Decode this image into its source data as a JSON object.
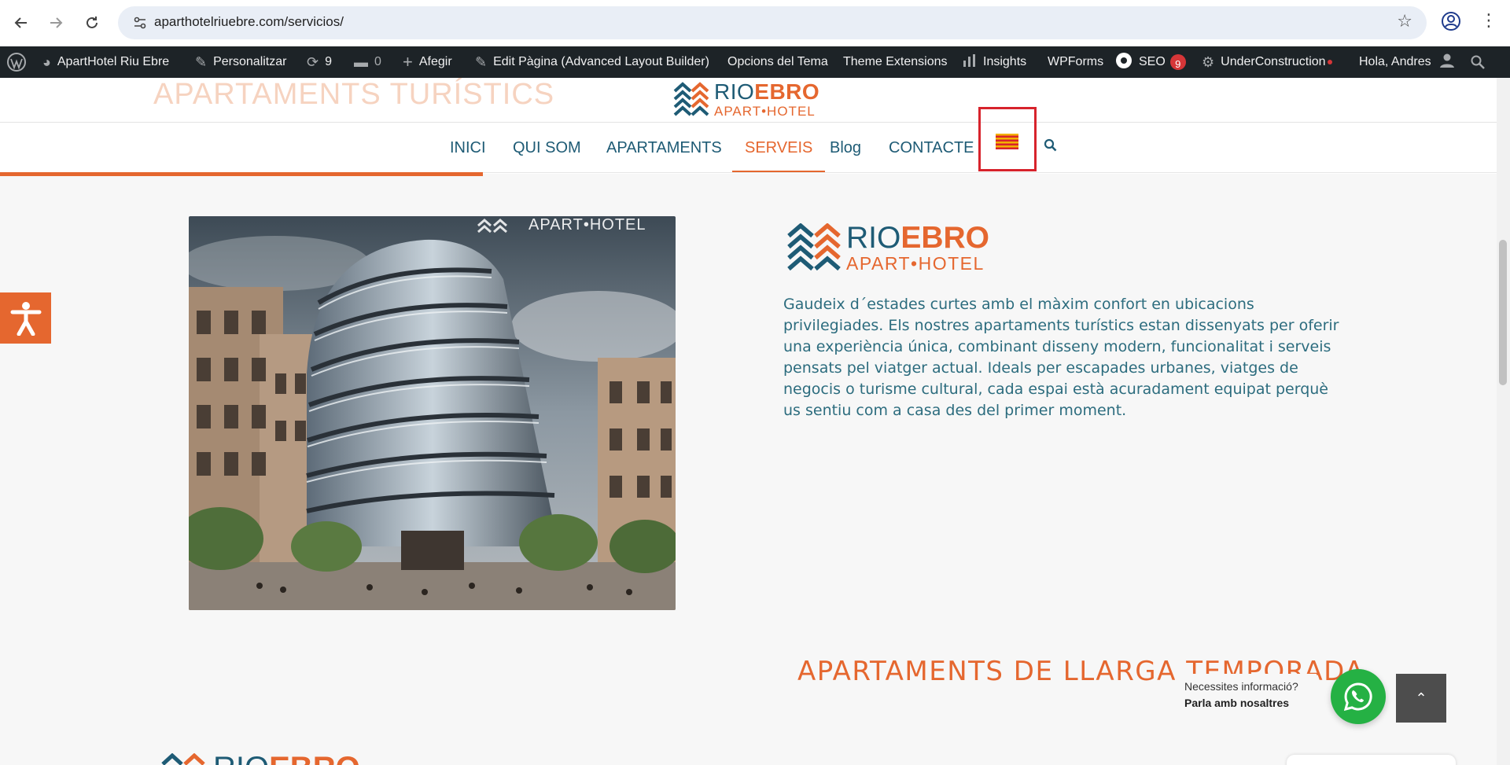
{
  "browser": {
    "url": "aparthotelriuebre.com/servicios/",
    "icons": [
      "back-icon",
      "forward-icon",
      "reload-icon",
      "site-info-icon",
      "bookmark-star-icon",
      "profile-icon",
      "menu-kebab-icon"
    ]
  },
  "admin_bar": {
    "site_name": "ApartHotel Riu Ebre",
    "customize": "Personalitzar",
    "updates_count": "9",
    "comments_count": "0",
    "add_new": "Afegir",
    "edit_page": "Edit Pàgina (Advanced Layout Builder)",
    "theme_options": "Opcions del Tema",
    "theme_extensions": "Theme Extensions",
    "insights": "Insights",
    "wpforms": "WPForms",
    "seo": "SEO",
    "seo_badge": "9",
    "under_construction": "UnderConstruction",
    "greeting": "Hola, Andres"
  },
  "header": {
    "faded_title": "APARTAMENTS TURÍSTICS",
    "logo": {
      "word1": "RIO",
      "word2": "EBRO",
      "sub": "APART•HOTEL"
    },
    "menu": [
      {
        "label": "INICI"
      },
      {
        "label": "QUI SOM"
      },
      {
        "label": "APARTAMENTS"
      },
      {
        "label": "SERVEIS",
        "active": true
      },
      {
        "label": "Blog"
      },
      {
        "label": "CONTACTE"
      }
    ],
    "scroll_progress_percent": 32
  },
  "content": {
    "photo_watermark": "APART•HOTEL",
    "logo": {
      "word1": "RIO",
      "word2": "EBRO",
      "sub": "APART•HOTEL"
    },
    "paragraph": "Gaudeix d´estades curtes amb el màxim confort en ubicacions privilegiades. Els nostres apartaments turístics estan dissenyats per oferir una experiència única, combinant disseny modern, funcionalitat i serveis pensats pel viatger actual. Ideals per escapades urbanes, viatges de negocis o turisme cultural, cada espai està acuradament equipat perquè us sentiu com a casa des del primer moment.",
    "section_title": "APARTAMENTS DE LLARGA TEMPORADA",
    "bottom_logo": {
      "word1": "RIO",
      "word2": "EBRO"
    }
  },
  "whatsapp": {
    "line1": "Necessites informació?",
    "line2": "Parla amb nosaltres"
  },
  "colors": {
    "brand_orange": "#e5672f",
    "brand_teal": "#1e5b75",
    "admin_bar": "#1d2327",
    "whatsapp_green": "#25b144",
    "highlight_red": "#d7232c"
  }
}
